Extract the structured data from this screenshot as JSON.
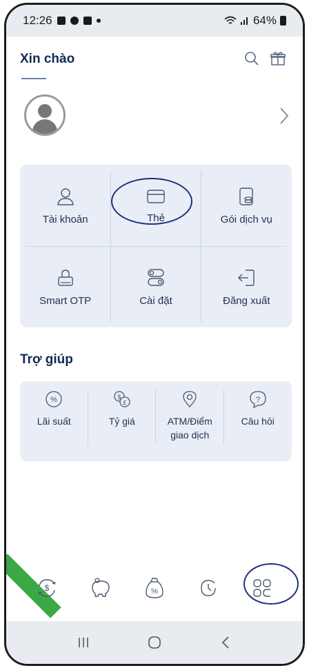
{
  "status_bar": {
    "time": "12:26",
    "battery": "64%"
  },
  "header": {
    "greeting": "Xin chào"
  },
  "menu": {
    "items": [
      {
        "label": "Tài khoản",
        "icon": "user-icon"
      },
      {
        "label": "Thẻ",
        "icon": "card-icon"
      },
      {
        "label": "Gói dịch vụ",
        "icon": "service-package-icon"
      },
      {
        "label": "Smart OTP",
        "icon": "lock-icon"
      },
      {
        "label": "Cài đặt",
        "icon": "settings-toggle-icon"
      },
      {
        "label": "Đăng xuất",
        "icon": "logout-icon"
      }
    ]
  },
  "help": {
    "title": "Trợ giúp",
    "items": [
      {
        "label": "Lãi suất",
        "icon": "interest-rate-icon"
      },
      {
        "label": "Tỷ giá",
        "icon": "exchange-rate-icon"
      },
      {
        "label": "ATM/Điểm giao dịch",
        "icon": "location-pin-icon"
      },
      {
        "label": "Câu hỏi",
        "icon": "question-icon"
      }
    ]
  },
  "bottom_nav": {
    "items": [
      "transfer-icon",
      "savings-icon",
      "money-bag-icon",
      "history-icon",
      "menu-grid-icon"
    ]
  },
  "colors": {
    "accent": "#0f2a55",
    "card_bg": "#e9eef6",
    "annotation": "#1d2f7a"
  }
}
